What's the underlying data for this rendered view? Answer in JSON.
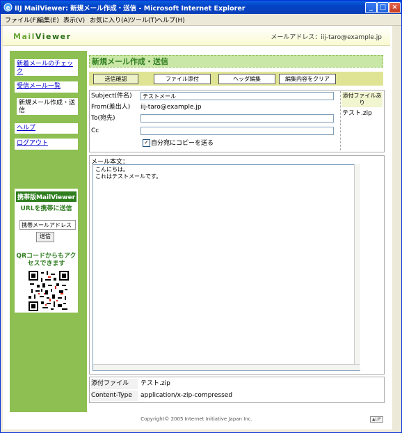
{
  "window": {
    "title": "IIJ MailViewer: 新規メール作成・送信 - Microsoft Internet Explorer"
  },
  "menubar": {
    "items": [
      "ファイル(F)",
      "編集(E)",
      "表示(V)",
      "お気に入り(A)",
      "ツール(T)",
      "ヘルプ(H)"
    ]
  },
  "header": {
    "logo_a": "Mail",
    "logo_b": "Viewer",
    "mail_address": "メールアドレス：iij-taro@example.jp"
  },
  "sidebar": {
    "items": [
      "新着メールのチェック",
      "受信メール一覧",
      "新規メール作成・送信",
      "ヘルプ",
      "ログアウト"
    ],
    "mobile_title": "携帯版MailViewer",
    "mobile_sub": "URLを携帯に送信",
    "mobile_placeholder": "携帯メールアドレス",
    "mobile_send": "送信",
    "qr_text": "QRコードからもアクセスできます"
  },
  "main": {
    "page_title": "新規メール作成・送信",
    "toolbar": [
      "送信確認",
      "ファイル添付",
      "ヘッダ編集",
      "編集内容をクリア"
    ],
    "form": {
      "subject_label": "Subject(件名)",
      "subject_value": "テストメール",
      "from_label": "From(差出人)",
      "from_value": "iij-taro@example.jp",
      "to_label": "To(宛先)",
      "to_value": "",
      "cc_label": "Cc",
      "cc_value": "",
      "copy_label": "自分宛にコピーを送る",
      "attach_header": "添付ファイルあり",
      "attach_file": "テスト.zip"
    },
    "body_label": "メール本文：",
    "body_text": "こんにちは。\nこれはテストメールです。",
    "info": {
      "attach_label": "添付ファイル",
      "attach_value": "テスト.zip",
      "ctype_label": "Content-Type",
      "ctype_value": "application/x-zip-compressed"
    }
  },
  "footer": {
    "copyright": "Copyright© 2005 Internet Initiative Japan Inc.",
    "up": "▲UP"
  }
}
